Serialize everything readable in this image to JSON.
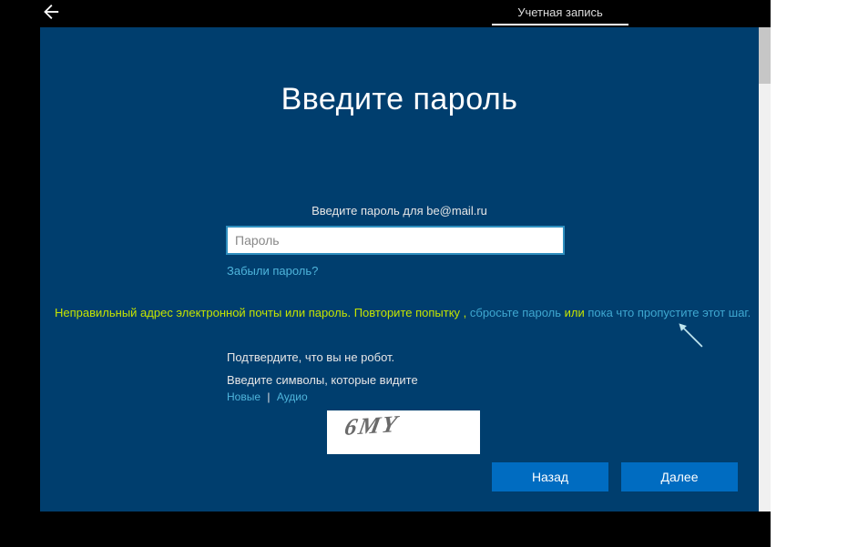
{
  "topbar": {
    "tab_label": "Учетная запись"
  },
  "page": {
    "title": "Введите пароль",
    "prompt": "Введите пароль для be@mail.ru",
    "password_placeholder": "Пароль",
    "forgot_link": "Забыли пароль?"
  },
  "error": {
    "wrong_credentials": "Неправильный адрес электронной почты или пароль. Повторите попытку",
    "comma": " , ",
    "reset_password": "сбросьте пароль",
    "or": " или ",
    "skip_step": "пока что пропустите этот шаг.",
    "message_color": "#c6e400"
  },
  "captcha": {
    "confirm_text": "Подтвердите, что вы не робот.",
    "instruction": "Введите символы, которые видите",
    "new_link": "Новые",
    "audio_link": "Аудио",
    "image_text": "6MY"
  },
  "buttons": {
    "back": "Назад",
    "next": "Далее"
  },
  "colors": {
    "panel_bg": "#003e6e",
    "button_bg": "#006cc1",
    "link_blue": "#4fb5dc"
  }
}
